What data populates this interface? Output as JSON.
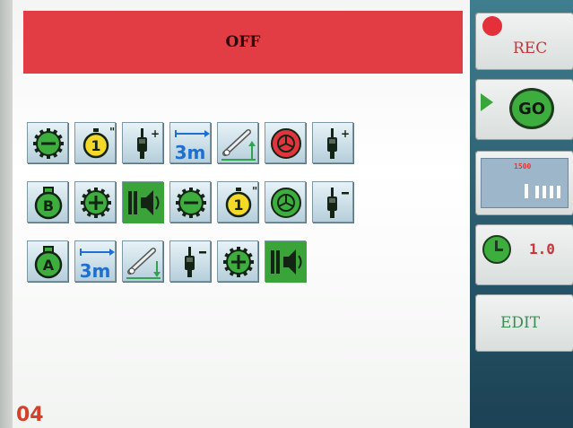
{
  "status_bar": {
    "text": "OFF",
    "color": "#e23c45"
  },
  "sidebar": {
    "rec_label": "REC",
    "go_label": "GO",
    "display_value": "1500",
    "timer_value": "1.0",
    "edit_label": "EDIT"
  },
  "grid": {
    "rows": [
      [
        "minus-gear-icon",
        "stopwatch-1-icon",
        "cylinder-plus-icon",
        "distance-3m-icon",
        "lift-arm-up-icon",
        "red-disc-icon",
        "cylinder-plus-icon"
      ],
      [
        "bucket-b-icon",
        "plus-gear-icon",
        "sound-icon",
        "minus-gear-icon",
        "stopwatch-1-icon",
        "green-disc-icon",
        "cylinder-minus-icon"
      ],
      [
        "bucket-a-icon",
        "distance-3m-icon",
        "lift-arm-down-icon",
        "cylinder-minus-icon",
        "plus-gear-icon",
        "sound-icon"
      ]
    ],
    "labels": {
      "stopwatch": "1",
      "stopwatch_mark": "\"",
      "distance": "3m",
      "bucket_b": "B",
      "bucket_a": "A"
    }
  },
  "page_number": "04",
  "colors": {
    "accent_green": "#3dad3d",
    "accent_red": "#e23c45",
    "sidebar_bg": "#27566a"
  }
}
